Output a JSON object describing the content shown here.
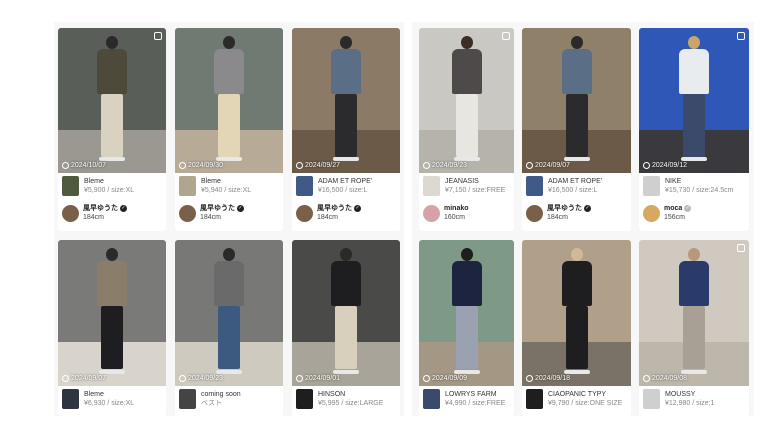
{
  "cards": [
    {
      "date": "2024/10/07",
      "brand": "Bleme",
      "price": "¥5,900 / size:XL",
      "user": "風早ゆうた",
      "height": "184cm",
      "verified": "dark",
      "multi": true
    },
    {
      "date": "2024/09/30",
      "brand": "Bleme",
      "price": "¥5,940 / size:XL",
      "user": "風早ゆうた",
      "height": "184cm",
      "verified": "dark",
      "multi": false
    },
    {
      "date": "2024/09/27",
      "brand": "ADAM ET ROPE'",
      "price": "¥16,500 / size:L",
      "user": "風早ゆうた",
      "height": "184cm",
      "verified": "dark",
      "multi": false
    },
    {
      "date": "2024/09/23",
      "brand": "JEANASIS",
      "price": "¥7,150 / size:FREE",
      "user": "minako",
      "height": "160cm",
      "verified": "none",
      "multi": true
    },
    {
      "date": "2024/09/07",
      "brand": "ADAM ET ROPE'",
      "price": "¥16,500 / size:L",
      "user": "風早ゆうた",
      "height": "184cm",
      "verified": "dark",
      "multi": false
    },
    {
      "date": "2024/09/12",
      "brand": "NIKE",
      "price": "¥15,730 / size:24.5cm",
      "user": "moca",
      "height": "156cm",
      "verified": "gray",
      "multi": true
    },
    {
      "date": "2024/09/07",
      "brand": "Bleme",
      "price": "¥6,930 / size:XL",
      "user": "",
      "height": "",
      "verified": "none",
      "multi": false
    },
    {
      "date": "2024/09/23",
      "brand": "coming soon",
      "price": "ベスト",
      "user": "",
      "height": "",
      "verified": "none",
      "multi": false
    },
    {
      "date": "2024/09/01",
      "brand": "HINSON",
      "price": "¥5,995 / size:LARGE",
      "user": "",
      "height": "",
      "verified": "none",
      "multi": false
    },
    {
      "date": "2024/09/09",
      "brand": "LOWRYS FARM",
      "price": "¥4,990 / size:FREE",
      "user": "",
      "height": "",
      "verified": "none",
      "multi": false
    },
    {
      "date": "2024/09/18",
      "brand": "CIAOPANIC TYPY",
      "price": "¥9,790 / size:ONE SIZE",
      "user": "",
      "height": "",
      "verified": "none",
      "multi": false
    },
    {
      "date": "2024/09/08",
      "brand": "MOUSSY",
      "price": "¥12,980 / size:1",
      "user": "",
      "height": "",
      "verified": "none",
      "multi": true
    }
  ],
  "colors": {
    "panel": "#f7f7f7",
    "text": "#333333",
    "muted": "#888888"
  }
}
